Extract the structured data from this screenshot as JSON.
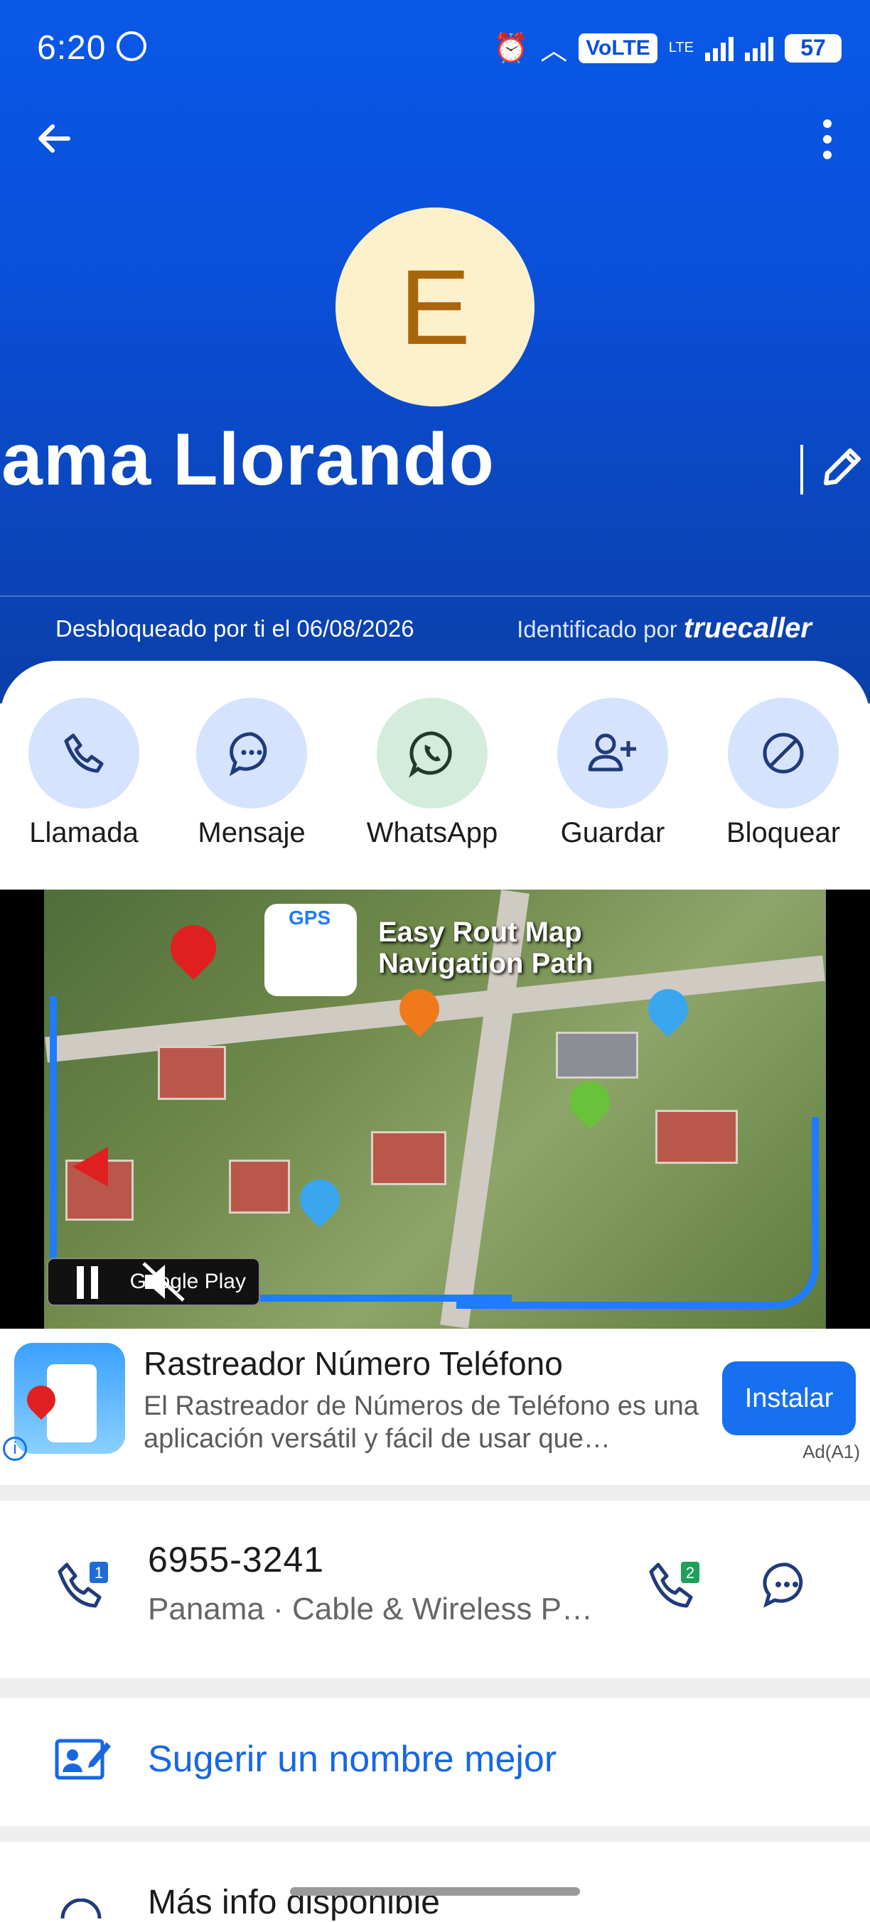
{
  "status_bar": {
    "time": "6:20",
    "volte": "VoLTE",
    "lte": "LTE",
    "battery": "57"
  },
  "header": {
    "avatar_letter": "E",
    "contact_name": "ama Llorando",
    "unlocked_text": "Desbloqueado por ti el 06/08/2026",
    "identified_prefix": "Identificado por",
    "identified_brand": "truecaller"
  },
  "actions": [
    {
      "label": "Llamada",
      "color": "#d6e3ff"
    },
    {
      "label": "Mensaje",
      "color": "#d6e3ff"
    },
    {
      "label": "WhatsApp",
      "color": "#d4ecdb"
    },
    {
      "label": "Guardar",
      "color": "#d6e3ff"
    },
    {
      "label": "Bloquear",
      "color": "#d6e3ff"
    }
  ],
  "ad": {
    "video_title_line1": "Easy Rout Map",
    "video_title_line2": "Navigation Path",
    "gps_label": "GPS",
    "store_badge": "Google Play",
    "title": "Rastreador Número Teléfono",
    "description": "El Rastreador de Números de Teléfono es una aplicación versátil y fácil de usar que…",
    "install_label": "Instalar",
    "ad_label": "Ad(A1)"
  },
  "phone": {
    "number": "6955-3241",
    "carrier": "Panama · Cable & Wireless P…",
    "sim1_badge": "1",
    "sim2_badge": "2"
  },
  "suggest_label": "Sugerir un nombre mejor",
  "more_info_label": "Más info disponible",
  "colors": {
    "accent": "#1767e5",
    "header_blue": "#0a4fd8"
  }
}
